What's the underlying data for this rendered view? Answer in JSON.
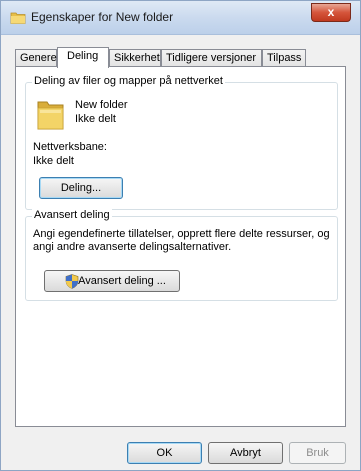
{
  "window": {
    "title": "Egenskaper for New folder",
    "close_glyph": "x"
  },
  "tabs": [
    {
      "label": "Generelt",
      "active": false
    },
    {
      "label": "Deling",
      "active": true
    },
    {
      "label": "Sikkerhet",
      "active": false
    },
    {
      "label": "Tidligere versjoner",
      "active": false
    },
    {
      "label": "Tilpass",
      "active": false
    }
  ],
  "network_sharing": {
    "group_title": "Deling av filer og mapper på nettverket",
    "folder_name": "New folder",
    "folder_status": "Ikke delt",
    "path_label": "Nettverksbane:",
    "path_value": "Ikke delt",
    "share_button": "Deling..."
  },
  "advanced_sharing": {
    "group_title": "Avansert deling",
    "description_line1": "Angi egendefinerte tillatelser, opprett flere delte ressurser, og",
    "description_line2": "angi andre avanserte delingsalternativer.",
    "button": "Avansert deling ..."
  },
  "footer": {
    "ok": "OK",
    "cancel": "Avbryt",
    "apply": "Bruk"
  },
  "icons": {
    "title": "folder-icon",
    "folder": "folder-icon",
    "advanced": "shield-icon"
  },
  "colors": {
    "close_button": "#c9472d",
    "focus_border": "#3c7fb1",
    "folder_yellow": "#e9c453"
  }
}
